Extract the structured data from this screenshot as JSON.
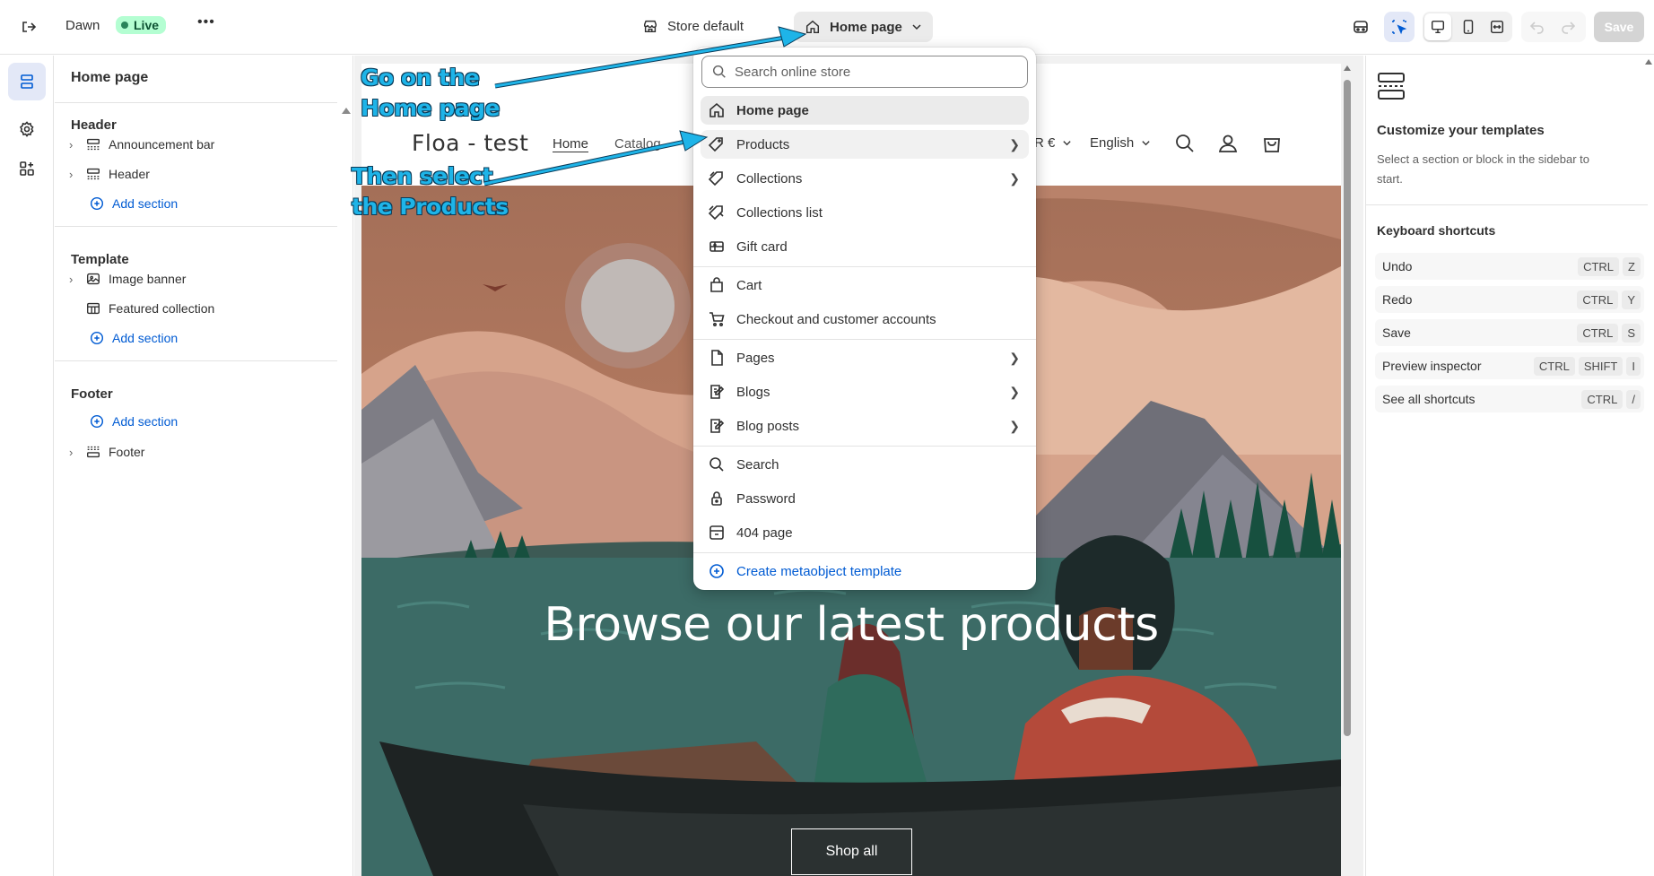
{
  "topbar": {
    "theme_name": "Dawn",
    "live_badge": "Live",
    "more_label": "•••",
    "store_label": "Store default",
    "page_selector": "Home page",
    "save_label": "Save"
  },
  "sidebar": {
    "title": "Home page",
    "groups": [
      {
        "title": "Header",
        "items": [
          "Announcement bar",
          "Header"
        ],
        "add": "Add section"
      },
      {
        "title": "Template",
        "items": [
          "Image banner",
          "Featured collection"
        ],
        "add": "Add section"
      },
      {
        "title": "Footer",
        "items": [
          "Footer"
        ],
        "add": "Add section"
      }
    ]
  },
  "store": {
    "logo": "Floa - test",
    "nav": [
      "Home",
      "Catalog"
    ],
    "currency_fragment": "R €",
    "language": "English",
    "hero_title": "Browse our latest products",
    "hero_button": "Shop all"
  },
  "menu": {
    "search_placeholder": "Search online store",
    "items": [
      {
        "label": "Home page",
        "icon": "home-icon",
        "submenu": false
      },
      {
        "label": "Products",
        "icon": "tag-icon",
        "submenu": true
      },
      {
        "label": "Collections",
        "icon": "collection-icon",
        "submenu": true
      },
      {
        "label": "Collections list",
        "icon": "collections-list-icon",
        "submenu": false
      },
      {
        "label": "Gift card",
        "icon": "gift-card-icon",
        "submenu": false
      },
      {
        "label": "Cart",
        "icon": "bag-icon",
        "submenu": false
      },
      {
        "label": "Checkout and customer accounts",
        "icon": "cart-icon",
        "submenu": false
      },
      {
        "label": "Pages",
        "icon": "page-icon",
        "submenu": true
      },
      {
        "label": "Blogs",
        "icon": "blog-icon",
        "submenu": true
      },
      {
        "label": "Blog posts",
        "icon": "blog-post-icon",
        "submenu": true
      },
      {
        "label": "Search",
        "icon": "search-icon",
        "submenu": false
      },
      {
        "label": "Password",
        "icon": "lock-icon",
        "submenu": false
      },
      {
        "label": "404 page",
        "icon": "error-page-icon",
        "submenu": false
      },
      {
        "label": "Create metaobject template",
        "icon": "plus-circle-icon",
        "submenu": false
      }
    ]
  },
  "right_panel": {
    "heading": "Customize your templates",
    "description": "Select a section or block in the sidebar to start.",
    "shortcuts_title": "Keyboard shortcuts",
    "shortcuts": [
      {
        "label": "Undo",
        "keys": [
          "CTRL",
          "Z"
        ]
      },
      {
        "label": "Redo",
        "keys": [
          "CTRL",
          "Y"
        ]
      },
      {
        "label": "Save",
        "keys": [
          "CTRL",
          "S"
        ]
      },
      {
        "label": "Preview inspector",
        "keys": [
          "CTRL",
          "SHIFT",
          "I"
        ]
      },
      {
        "label": "See all shortcuts",
        "keys": [
          "CTRL",
          "/"
        ]
      }
    ]
  },
  "annotations": {
    "first_line1": "Go on the",
    "first_line2": "Home page",
    "second_line1": "Then select",
    "second_line2": "the Products"
  },
  "colors": {
    "accent": "#005bd3",
    "annotation": "#1eb4e8",
    "live": "#b4fed2"
  }
}
